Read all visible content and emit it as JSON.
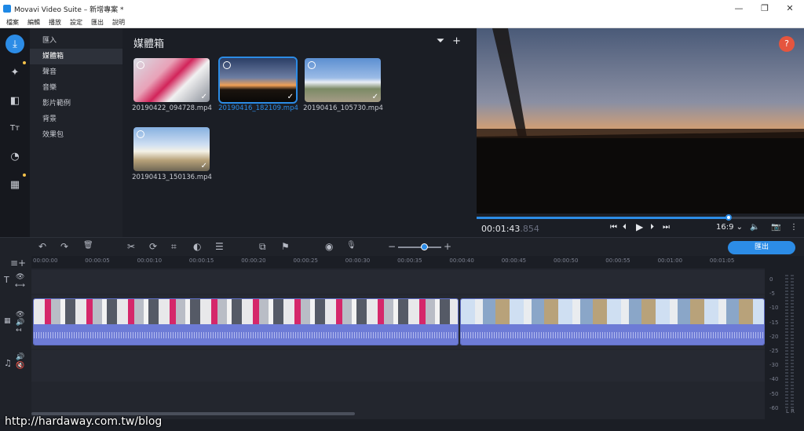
{
  "window": {
    "title": "Movavi Video Suite – 新增專案 *",
    "minimize": "—",
    "maximize": "❐",
    "close": "✕"
  },
  "menu": [
    "檔案",
    "編輯",
    "播放",
    "設定",
    "匯出",
    "說明"
  ],
  "leftbar": {
    "icons": [
      "import-icon",
      "magic-wand-icon",
      "transition-icon",
      "text-icon",
      "sticker-icon",
      "more-tools-icon"
    ],
    "glyphs": [
      "⤓",
      "✦",
      "◧",
      "Tт",
      "◔",
      "▦"
    ],
    "accent": "#2c8ce6"
  },
  "sidemenu": [
    "匯入",
    "媒體箱",
    "聲音",
    "音樂",
    "影片範例",
    "背景",
    "效果包"
  ],
  "media": {
    "title": "媒體箱",
    "filter_glyph": "⏷",
    "add_glyph": "+",
    "clips": [
      {
        "name": "20190422_094728.mp4"
      },
      {
        "name": "20190416_182109.mp4"
      },
      {
        "name": "20190416_105730.mp4"
      },
      {
        "name": "20190413_150136.mp4"
      }
    ]
  },
  "preview": {
    "help": "?",
    "time": "00:01:43",
    "time_ms": ".854",
    "progress": 0.77,
    "aspect": "16:9 ⌄",
    "buttons": {
      "prev": "⏮",
      "back": "⏴",
      "play": "▶",
      "fwd": "⏵",
      "next": "⏭",
      "volume": "🔈",
      "snapshot": "📷",
      "more": "⋮"
    }
  },
  "toolbar": {
    "glyphs": {
      "undo": "↶",
      "redo": "↷",
      "delete": "🗑",
      "cut": "✂",
      "rotate": "⟳",
      "crop": "⌗",
      "color": "◐",
      "adjust": "☰",
      "pip": "⧉",
      "marker": "⚑",
      "webcam": "◉",
      "mic": "🎙",
      "zoom_out": "−",
      "zoom_in": "+"
    },
    "zoom": 0.55,
    "export": "匯出"
  },
  "ruler": [
    "00:00:00",
    "00:00:05",
    "00:00:10",
    "00:00:15",
    "00:00:20",
    "00:00:25",
    "00:00:30",
    "00:00:35",
    "00:00:40",
    "00:00:45",
    "00:00:50",
    "00:00:55",
    "00:01:00",
    "00:01:05"
  ],
  "meter": [
    "0",
    "-5",
    "-10",
    "-15",
    "-20",
    "-25",
    "-30",
    "-40",
    "-50",
    "-60"
  ],
  "meter_lr": "L R",
  "watermark": "http://hardaway.com.tw/blog"
}
